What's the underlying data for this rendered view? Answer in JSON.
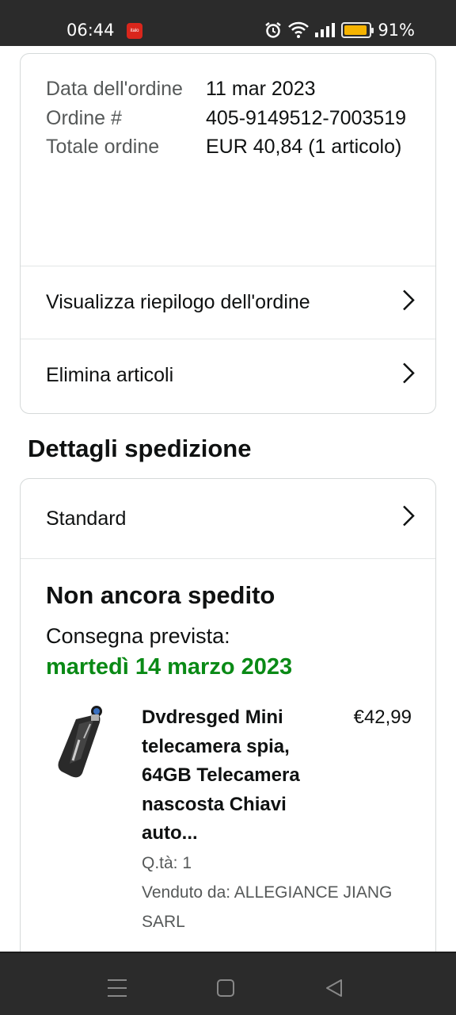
{
  "status_bar": {
    "time": "06:44",
    "app_icon_text": "italo",
    "battery_percent": "91%",
    "battery_level": 0.91
  },
  "order": {
    "date_label": "Data dell'ordine",
    "date_value": "11 mar 2023",
    "number_label": "Ordine #",
    "number_value": "405-9149512-7003519",
    "total_label": "Totale ordine",
    "total_value": "EUR 40,84 (1 articolo)"
  },
  "links": {
    "summary": "Visualizza riepilogo dell'ordine",
    "delete": "Elimina articoli"
  },
  "shipping": {
    "section_title": "Dettagli spedizione",
    "method": "Standard",
    "status": "Non ancora spedito",
    "expected_label": "Consegna prevista:",
    "expected_date": "martedì 14 marzo 2023",
    "accent_color": "#0a8a16"
  },
  "product": {
    "title": "Dvdresged Mini telecamera spia, 64GB Telecamera nascosta Chiavi auto...",
    "price": "€42,99",
    "quantity": "Q.tà: 1",
    "seller": "Venduto da: ALLEGIANCE JIANG SARL"
  }
}
